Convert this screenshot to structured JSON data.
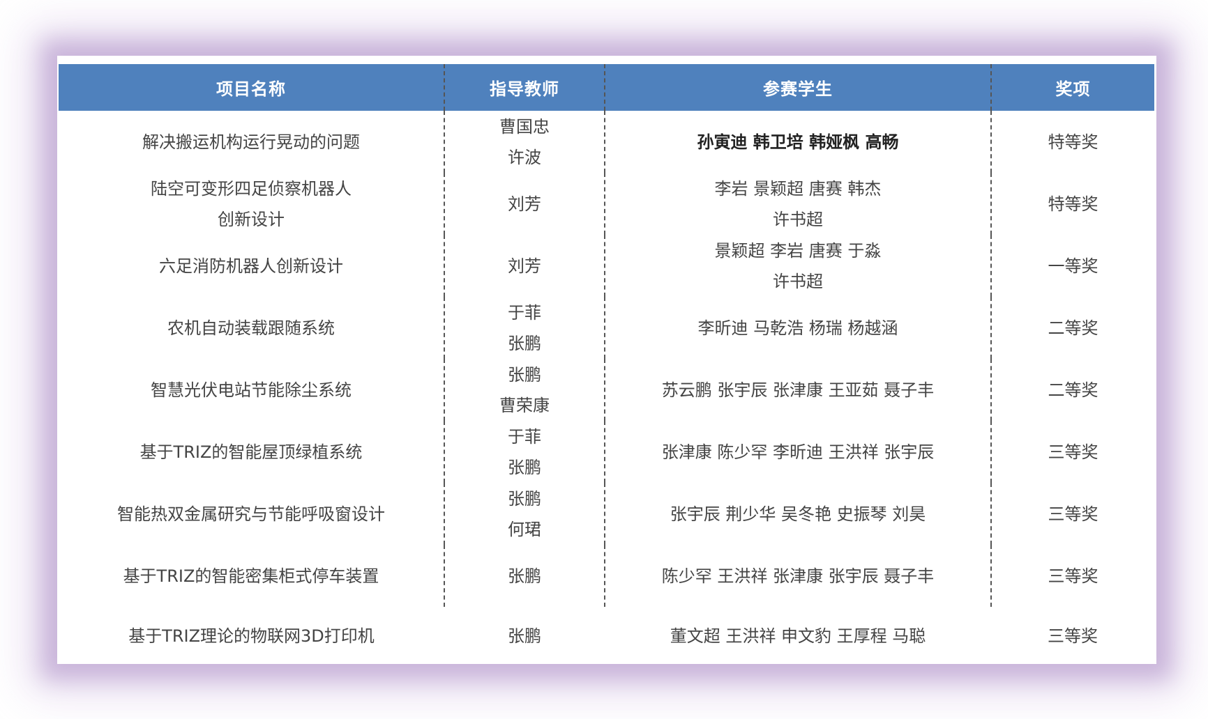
{
  "headers": {
    "project": "项目名称",
    "teacher": "指导教师",
    "students": "参赛学生",
    "award": "奖项"
  },
  "rows": [
    {
      "project": [
        "解决搬运机构运行晃动的问题"
      ],
      "teachers": [
        "曹国忠",
        "许波"
      ],
      "students": [
        "孙寅迪 韩卫培 韩娅枫 高畅"
      ],
      "award": "特等奖"
    },
    {
      "project": [
        "陆空可变形四足侦察机器人",
        "创新设计"
      ],
      "teachers": [
        "刘芳"
      ],
      "students": [
        "李岩  景颖超  唐赛  韩杰",
        "许书超"
      ],
      "award": "特等奖"
    },
    {
      "project": [
        "六足消防机器人创新设计"
      ],
      "teachers": [
        "刘芳"
      ],
      "students": [
        "景颖超  李岩  唐赛  于淼",
        "许书超"
      ],
      "award": "一等奖"
    },
    {
      "project": [
        "农机自动装载跟随系统"
      ],
      "teachers": [
        "于菲",
        "张鹏"
      ],
      "students": [
        "李昕迪  马乾浩  杨瑞  杨越涵"
      ],
      "award": "二等奖"
    },
    {
      "project": [
        "智慧光伏电站节能除尘系统"
      ],
      "teachers": [
        "张鹏",
        "曹荣康"
      ],
      "students": [
        "苏云鹏  张宇辰  张津康  王亚茹  聂子丰"
      ],
      "award": "二等奖"
    },
    {
      "project": [
        "基于TRIZ的智能屋顶绿植系统"
      ],
      "teachers": [
        "于菲",
        "张鹏"
      ],
      "students": [
        "张津康  陈少罕  李昕迪  王洪祥  张宇辰"
      ],
      "award": "三等奖"
    },
    {
      "project": [
        "智能热双金属研究与节能呼吸窗设计"
      ],
      "teachers": [
        "张鹏",
        "何珺"
      ],
      "students": [
        "张宇辰  荆少华  吴冬艳  史振琴  刘昊"
      ],
      "award": "三等奖"
    },
    {
      "project": [
        "基于TRIZ的智能密集柜式停车装置"
      ],
      "teachers": [
        "张鹏"
      ],
      "students": [
        "陈少罕  王洪祥  张津康  张宇辰  聂子丰"
      ],
      "award": "三等奖"
    },
    {
      "project": [
        "基于TRIZ理论的物联网3D打印机"
      ],
      "teachers": [
        "张鹏"
      ],
      "students": [
        "董文超  王洪祥  申文豹  王厚程  马聪"
      ],
      "award": "三等奖"
    }
  ]
}
